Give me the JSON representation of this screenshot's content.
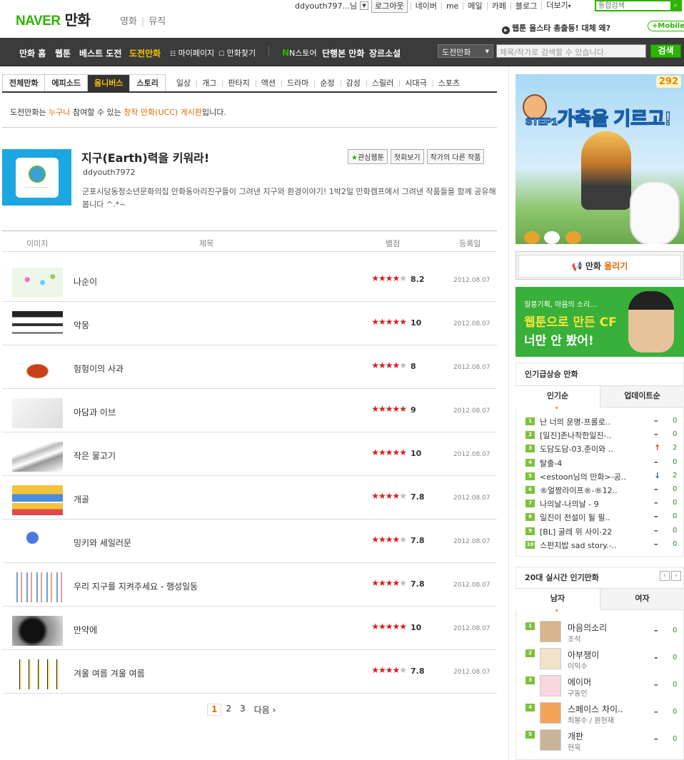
{
  "header": {
    "logo": "NAVER",
    "service": "만화",
    "service_tabs": [
      "영화",
      "뮤직"
    ],
    "user": "ddyouth797...님",
    "logout": "로그아웃",
    "util_links": [
      "네이버",
      "me",
      "메일",
      "카페",
      "블로그",
      "더보기"
    ],
    "more_arrow": "▾",
    "search_placeholder": "통합검색",
    "notice": "웹툰 올스타 총출동! 대체 왜?",
    "mobile": "+Mobile"
  },
  "nav": {
    "items": [
      "만화 홈",
      "웹툰",
      "베스트 도전",
      "도전만화"
    ],
    "items_small": [
      "마이페이지",
      "만화찾기"
    ],
    "items_right": [
      "N스토어",
      "단행본 만화",
      "장르소설"
    ],
    "select_value": "도전만화",
    "search_placeholder": "제목/작가로 검색할 수 있습니다.",
    "search_button": "검색"
  },
  "subtabs": {
    "main": [
      "전체만화",
      "에피소드",
      "옴니버스",
      "스토리"
    ],
    "active": "옴니버스",
    "genres": [
      "일상",
      "개그",
      "판타지",
      "액션",
      "드라마",
      "순정",
      "감성",
      "스릴러",
      "시대극",
      "스포츠"
    ]
  },
  "intro": {
    "prefix": "도전만화는 ",
    "hl1": "누구나",
    "mid": " 참여할 수 있는 ",
    "hl2": "창작 만화(UCC) 게시판",
    "suffix": "입니다."
  },
  "webtoon": {
    "title": "지구(Earth)력을 키워라!",
    "author": "ddyouth7972",
    "description": "군포시당동청소년문화의집 만화동아리친구들이 그려낸 지구와 환경이야기! 1박2일 만화캠프에서 그려낸 작품들을 함께 공유해봅니다 ^.*~",
    "buttons": {
      "fav": "관심웹툰",
      "first": "첫회보기",
      "others": "작가의 다른 작품"
    }
  },
  "list_head": {
    "image": "이미지",
    "title": "제목",
    "rating": "별점",
    "date": "등록일"
  },
  "episodes": [
    {
      "title": "나순이",
      "stars": 4.1,
      "score": "8.2",
      "date": "2012.08.07"
    },
    {
      "title": "악몽",
      "stars": 5,
      "score": "10",
      "date": "2012.08.07"
    },
    {
      "title": "헝헝이의 사과",
      "stars": 4,
      "score": "8",
      "date": "2012.08.07"
    },
    {
      "title": "아담과 이브",
      "stars": 4.5,
      "score": "9",
      "date": "2012.08.07"
    },
    {
      "title": "작은 물고기",
      "stars": 5,
      "score": "10",
      "date": "2012.08.07"
    },
    {
      "title": "개골",
      "stars": 3.9,
      "score": "7.8",
      "date": "2012.08.07"
    },
    {
      "title": "밍키와 세일러문",
      "stars": 3.9,
      "score": "7.8",
      "date": "2012.08.07"
    },
    {
      "title": "우리 지구를 지켜주세요 - 행성일동",
      "stars": 3.9,
      "score": "7.8",
      "date": "2012.08.07"
    },
    {
      "title": "만약에",
      "stars": 5,
      "score": "10",
      "date": "2012.08.07"
    },
    {
      "title": "겨울 여름 겨울 여름",
      "stars": 3.9,
      "score": "7.8",
      "date": "2012.08.07"
    }
  ],
  "pager": {
    "pages": [
      "1",
      "2",
      "3"
    ],
    "current": "1",
    "next": "다음 ›"
  },
  "banner1": {
    "step": "STEP1",
    "text": "가축을 기르고!",
    "logo": "292"
  },
  "upload": {
    "prefix": "만화 ",
    "hl": "올리기"
  },
  "banner2": {
    "line1": "질풍기획, 마음의 소리...",
    "line2": "웹툰으로 만든 CF",
    "line3": "너만 안 봤어!"
  },
  "rising": {
    "title": "인기급상승 만화",
    "tabs": [
      "인기순",
      "업데이트순"
    ],
    "items": [
      {
        "num": "1",
        "name": "난 너의 운명-프롤로..",
        "change": "–",
        "count": "0",
        "dir": "dash"
      },
      {
        "num": "2",
        "name": "[일진]존나착한일진-..",
        "change": "–",
        "count": "0",
        "dir": "dash"
      },
      {
        "num": "3",
        "name": "도담도담-03.준이와 ..",
        "change": "↑",
        "count": "2",
        "dir": "up"
      },
      {
        "num": "4",
        "name": "탈출-4",
        "change": "–",
        "count": "0",
        "dir": "dash"
      },
      {
        "num": "5",
        "name": "<estoon님의 만화>-공..",
        "change": "↓",
        "count": "2",
        "dir": "dn"
      },
      {
        "num": "6",
        "name": "®얼짱라이프®-®12..",
        "change": "–",
        "count": "0",
        "dir": "dash"
      },
      {
        "num": "7",
        "name": "나의날-나의날 - 9",
        "change": "–",
        "count": "0",
        "dir": "dash"
      },
      {
        "num": "8",
        "name": "일진이 전설이 될 필..",
        "change": "–",
        "count": "0",
        "dir": "dash"
      },
      {
        "num": "9",
        "name": "[BL] 굴레 위 사이-22",
        "change": "–",
        "count": "0",
        "dir": "dash"
      },
      {
        "num": "10",
        "name": "스펀지밥 sad story.-..",
        "change": "–",
        "count": "0",
        "dir": "dash"
      }
    ]
  },
  "realtime": {
    "title": "20대 실시간 인기만화",
    "tabs": [
      "남자",
      "여자"
    ],
    "arrows": [
      "‹",
      "›"
    ],
    "items": [
      {
        "num": "1",
        "name": "마음의소리",
        "author": "조석",
        "change": "–",
        "count": "0"
      },
      {
        "num": "2",
        "name": "아부쟁이",
        "author": "이익수",
        "change": "–",
        "count": "0"
      },
      {
        "num": "3",
        "name": "에이머",
        "author": "구동인",
        "change": "–",
        "count": "0"
      },
      {
        "num": "4",
        "name": "스페이스 차이..",
        "author": "최봉수 / 원현재",
        "change": "–",
        "count": "0"
      },
      {
        "num": "5",
        "name": "개판",
        "author": "현욱",
        "change": "–",
        "count": "0"
      }
    ]
  }
}
